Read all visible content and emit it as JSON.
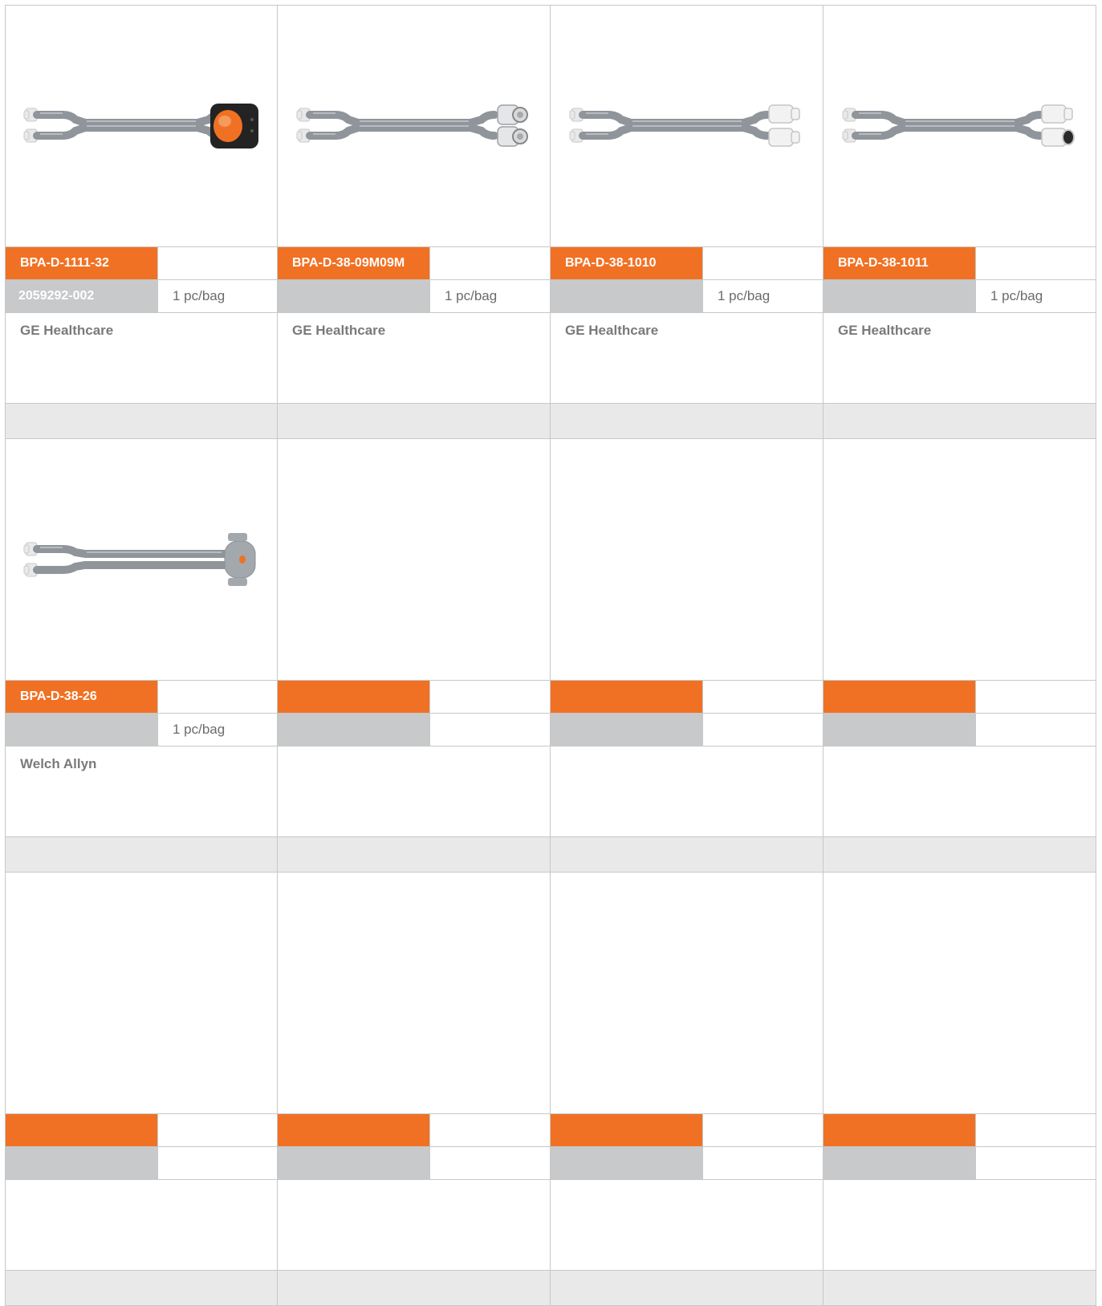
{
  "colors": {
    "code_bg": "#f07124",
    "ref_bg": "#c8c9cb",
    "footer_bg": "#e9e9e9",
    "grid_line": "#c8c8c8"
  },
  "products": [
    {
      "image": "hose-orange-grip-connector",
      "code": "BPA-D-1111-32",
      "ref": "2059292-002",
      "qty": "1 pc/bag",
      "maker": "GE Healthcare"
    },
    {
      "image": "hose-twin-metal-connectors",
      "code": "BPA-D-38-09M09M",
      "ref": "",
      "qty": "1 pc/bag",
      "maker": "GE Healthcare"
    },
    {
      "image": "hose-twin-white-connectors",
      "code": "BPA-D-38-1010",
      "ref": "",
      "qty": "1 pc/bag",
      "maker": "GE Healthcare"
    },
    {
      "image": "hose-white-black-connectors",
      "code": "BPA-D-38-1011",
      "ref": "",
      "qty": "1 pc/bag",
      "maker": "GE Healthcare"
    },
    {
      "image": "hose-gray-clip-connector",
      "code": "BPA-D-38-26",
      "ref": "",
      "qty": "1 pc/bag",
      "maker": "Welch Allyn"
    },
    {
      "image": "",
      "code": "",
      "ref": "",
      "qty": "",
      "maker": ""
    },
    {
      "image": "",
      "code": "",
      "ref": "",
      "qty": "",
      "maker": ""
    },
    {
      "image": "",
      "code": "",
      "ref": "",
      "qty": "",
      "maker": ""
    },
    {
      "image": "",
      "code": "",
      "ref": "",
      "qty": "",
      "maker": ""
    },
    {
      "image": "",
      "code": "",
      "ref": "",
      "qty": "",
      "maker": ""
    },
    {
      "image": "",
      "code": "",
      "ref": "",
      "qty": "",
      "maker": ""
    },
    {
      "image": "",
      "code": "",
      "ref": "",
      "qty": "",
      "maker": ""
    }
  ]
}
